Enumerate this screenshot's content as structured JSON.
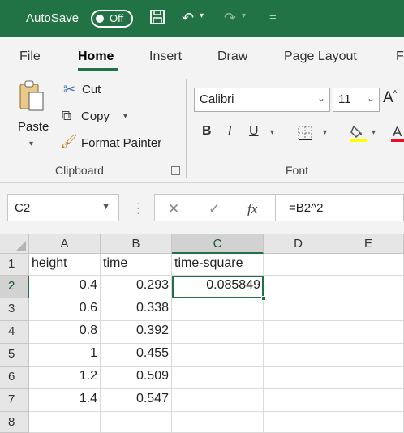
{
  "titlebar": {
    "autosave_label": "AutoSave",
    "autosave_state": "Off"
  },
  "tabs": [
    "File",
    "Home",
    "Insert",
    "Draw",
    "Page Layout",
    "F"
  ],
  "clipboard": {
    "paste": "Paste",
    "cut": "Cut",
    "copy": "Copy",
    "format_painter": "Format Painter",
    "group_label": "Clipboard"
  },
  "font": {
    "name": "Calibri",
    "size": "11",
    "bold": "B",
    "italic": "I",
    "underline": "U",
    "group_label": "Font"
  },
  "formula_bar": {
    "name_box": "C2",
    "formula": "=B2^2",
    "fx": "fx"
  },
  "sheet": {
    "columns": [
      "A",
      "B",
      "C",
      "D",
      "E"
    ],
    "rows": [
      "1",
      "2",
      "3",
      "4",
      "5",
      "6",
      "7",
      "8"
    ],
    "cells": {
      "A1": "height",
      "B1": "time",
      "C1": "time-square",
      "A2": "0.4",
      "B2": "0.293",
      "C2": "0.085849",
      "A3": "0.6",
      "B3": "0.338",
      "A4": "0.8",
      "B4": "0.392",
      "A5": "1",
      "B5": "0.455",
      "A6": "1.2",
      "B6": "0.509",
      "A7": "1.4",
      "B7": "0.547"
    },
    "active_cell": "C2"
  },
  "colors": {
    "accent": "#217346",
    "ribbon_bg": "#f3f3f3"
  }
}
